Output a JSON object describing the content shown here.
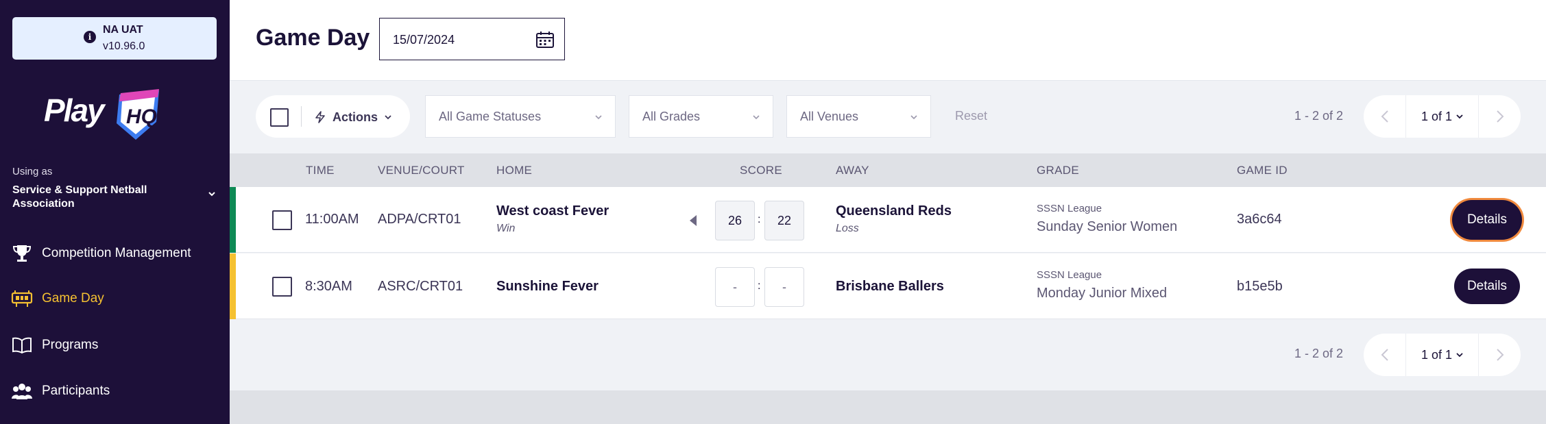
{
  "environment": {
    "name": "NA UAT",
    "version": "v10.96.0",
    "info_icon": "info-icon"
  },
  "logo": {
    "text": "Play",
    "badge": "HQ"
  },
  "org": {
    "using_as": "Using as",
    "name": "Service & Support Netball Association"
  },
  "nav": [
    {
      "label": "Competition Management",
      "icon": "trophy-icon",
      "active": false
    },
    {
      "label": "Game Day",
      "icon": "scoreboard-icon",
      "active": true
    },
    {
      "label": "Programs",
      "icon": "book-icon",
      "active": false
    },
    {
      "label": "Participants",
      "icon": "people-icon",
      "active": false
    }
  ],
  "header": {
    "title": "Game Day",
    "date": "15/07/2024"
  },
  "filters": {
    "actions_label": "Actions",
    "statuses": "All Game Statuses",
    "grades": "All Grades",
    "venues": "All Venues",
    "reset": "Reset"
  },
  "pagination": {
    "count": "1 - 2 of 2",
    "page": "1 of 1"
  },
  "columns": {
    "time": "TIME",
    "venue": "VENUE/COURT",
    "home": "HOME",
    "score": "SCORE",
    "away": "AWAY",
    "grade": "GRADE",
    "game_id": "GAME ID"
  },
  "games": [
    {
      "time": "11:00AM",
      "venue": "ADPA/CRT01",
      "home": "West coast Fever",
      "home_result": "Win",
      "home_score": "26",
      "away_score": "22",
      "away": "Queensland Reds",
      "away_result": "Loss",
      "league": "SSSN League",
      "grade": "Sunday Senior Women",
      "game_id": "3a6c64",
      "details": "Details",
      "status_color": "#0e8a55"
    },
    {
      "time": "8:30AM",
      "venue": "ASRC/CRT01",
      "home": "Sunshine Fever",
      "home_result": "",
      "home_score": "-",
      "away_score": "-",
      "away": "Brisbane Ballers",
      "away_result": "",
      "league": "SSSN League",
      "grade": "Monday Junior Mixed",
      "game_id": "b15e5b",
      "details": "Details",
      "status_color": "#f5c131"
    }
  ],
  "score_separator": ":",
  "colors": {
    "sidebar": "#1d1039",
    "active_nav": "#f5c131",
    "focus_ring": "#f08a3e"
  }
}
